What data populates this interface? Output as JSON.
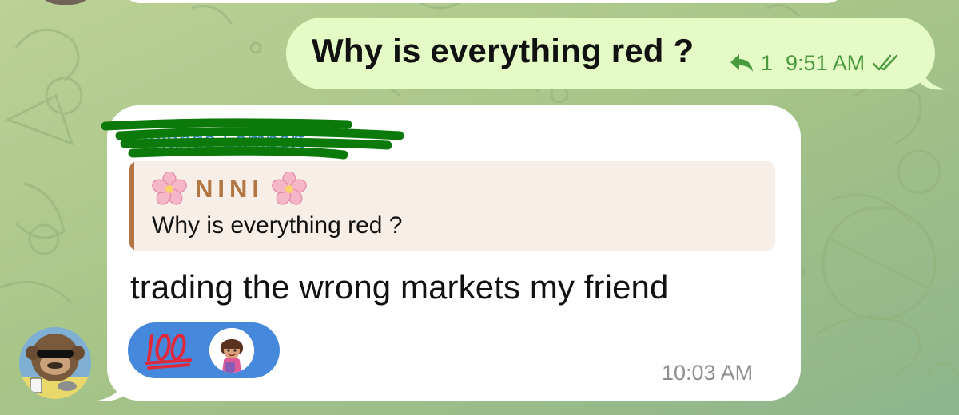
{
  "colors": {
    "wallpaper_start": "#b9cf93",
    "wallpaper_end": "#8fb58a",
    "outgoing_bubble": "#e4fbc6",
    "outgoing_meta": "#4a9a3e",
    "incoming_bubble": "#ffffff",
    "sender_name": "#3d86c6",
    "quote_accent": "#b27645",
    "quote_background": "#f6eee7",
    "reaction_pill": "#4688db",
    "redaction_marker": "#0b7a0b",
    "timestamp": "#8e8e93"
  },
  "outgoing_message": {
    "text": "Why is everything red ?",
    "reply_count": "1",
    "time": "9:51 AM",
    "status_icon": "double-check-icon",
    "reply_icon": "reply-arrow-icon"
  },
  "incoming_message": {
    "sender_name": "Rolando Lambert",
    "sender_name_redacted": true,
    "quote": {
      "author": "NINI",
      "author_icon_left": "cherry-blossom-icon",
      "author_icon_right": "cherry-blossom-icon",
      "text": "Why is everything red ?"
    },
    "text": "trading the wrong markets my friend",
    "reaction": {
      "emoji_icon": "hundred-points-icon",
      "reactor_avatar_icon": "dora-avatar-icon"
    },
    "time": "10:03 AM"
  },
  "sender_avatar_icon": "monkey-avatar-icon"
}
